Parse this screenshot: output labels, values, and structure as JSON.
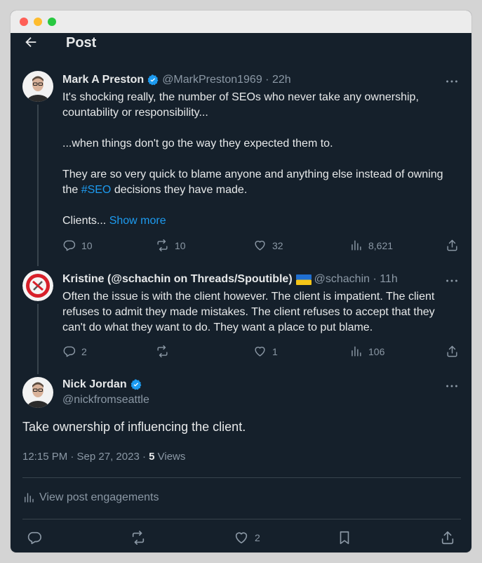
{
  "header": {
    "title": "Post"
  },
  "posts": [
    {
      "name": "Mark A Preston",
      "handle": "@MarkPreston1969 · 22h",
      "paragraphs": [
        "It's shocking really, the number of SEOs who never take any ownership, countability or responsibility...",
        "...when things don't go the way they expected them to."
      ],
      "para3_before": "They are so very quick to blame anyone and anything else instead of owning the ",
      "hashtag": "#SEO",
      "para3_after": " decisions they have made.",
      "truncated": "Clients...",
      "show_more": "Show more",
      "stats": {
        "replies": "10",
        "reposts": "10",
        "likes": "32",
        "views": "8,621"
      }
    },
    {
      "name": "Kristine (@schachin on Threads/Spoutible)",
      "flag": "Ukraine flag",
      "handle": "@schachin · 11h",
      "text": "Often the issue is with the client however. The client is impatient. The client refuses to admit they made mistakes. The client refuses to accept that they can't do what they want to do. They want a place to put blame.",
      "stats": {
        "replies": "2",
        "reposts": "",
        "likes": "1",
        "views": "106"
      }
    }
  ],
  "main_post": {
    "name": "Nick Jordan",
    "handle": "@nickfromseattle",
    "text": "Take ownership of influencing the client.",
    "timestamp": "12:15 PM · Sep 27, 2023 · ",
    "views_count": "5",
    "views_label": " Views",
    "engagements": "View post engagements",
    "actions": {
      "likes": "2"
    }
  },
  "colors": {
    "background": "#15202b",
    "accent": "#1d9bf0",
    "muted": "#8b98a5",
    "text": "#e7e9ea"
  }
}
